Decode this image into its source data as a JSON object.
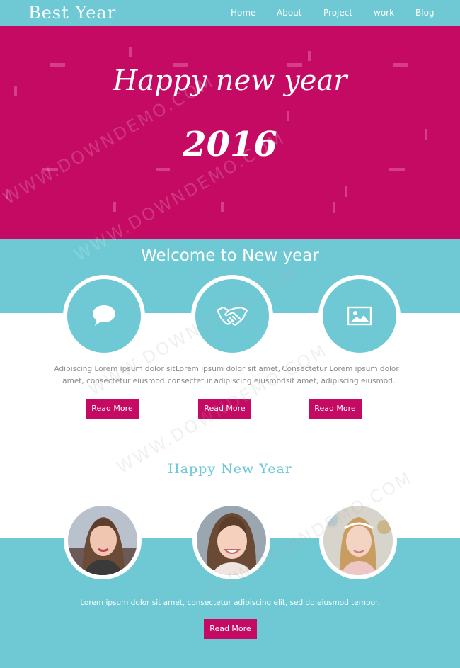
{
  "header": {
    "brand": "Best Year",
    "nav": [
      "Home",
      "About",
      "Project",
      "work",
      "Blog"
    ]
  },
  "hero": {
    "line1": "Happy new year",
    "line2": "2016",
    "watermark": "WWW.DOWNDEMO.COM"
  },
  "welcome": {
    "title": "Welcome to New year",
    "features": [
      {
        "icon": "chat-bubble-icon",
        "text": "Adipiscing Lorem ipsum dolor sit amet, consectetur eiusmod.",
        "button": "Read More"
      },
      {
        "icon": "handshake-icon",
        "text": "Lorem ipsum dolor sit amet, consectetur adipiscing eiusmod.",
        "button": "Read More"
      },
      {
        "icon": "image-icon",
        "text": "Consectetur Lorem ipsum dolor sit amet, adipiscing eiusmod.",
        "button": "Read More"
      }
    ]
  },
  "section2": {
    "title": "Happy New Year",
    "avatars": [
      "avatar-woman-dark-hair",
      "avatar-girl-smiling",
      "avatar-girl-blonde"
    ],
    "text": "Lorem ipsum dolor sit amet, consectetur adipiscing elit, sed do eiusmod tempor.",
    "button": "Read More"
  },
  "colors": {
    "teal": "#6ec9d4",
    "magenta": "#c40a63",
    "white": "#ffffff",
    "body_text": "#8b8b8b"
  }
}
